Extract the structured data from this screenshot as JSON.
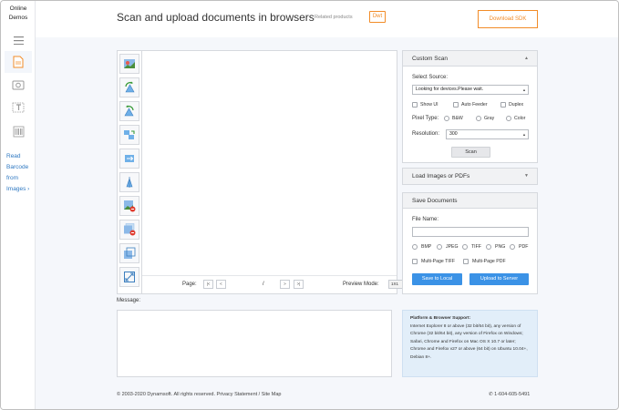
{
  "nav": {
    "brand_line1": "Online",
    "brand_line2": "Demos",
    "icons": [
      "menu-icon",
      "scan-document-icon",
      "webcam-icon",
      "ocr-text-icon",
      "barcode-icon"
    ],
    "barcode_link": [
      "Read",
      "Barcode",
      "from",
      "Images ›"
    ]
  },
  "header": {
    "title": "Scan and upload documents in browsers",
    "related_label": "Related products",
    "related_logo": "Dwt",
    "download_button": "Download SDK",
    "accent_color": "#f28c28"
  },
  "viewer": {
    "tools": [
      "select-image-icon",
      "rotate-left-icon",
      "rotate-right-icon",
      "mirror-icon",
      "flip-icon",
      "crop-icon",
      "remove-image-icon",
      "remove-all-icon",
      "change-size-icon",
      "fit-window-icon"
    ],
    "page_label": "Page:",
    "first_btn": "|<",
    "prev_btn": "<",
    "current_page": "",
    "page_separator": "/",
    "total_pages": "",
    "next_btn": ">",
    "last_btn": ">|",
    "preview_label": "Preview Mode:",
    "preview_value": "1X1"
  },
  "message": {
    "label": "Message:"
  },
  "custom_scan": {
    "title": "Custom Scan",
    "caret": "▲",
    "source_label": "Select Source:",
    "source_value": "Looking for devices.Please wait.",
    "options": [
      "Show UI",
      "Auto Feeder",
      "Duplex"
    ],
    "pixel_type_label": "Pixel Type:",
    "pixel_types": [
      "B&W",
      "Gray",
      "Color"
    ],
    "resolution_label": "Resolution:",
    "resolution_value": "300",
    "scan_button": "Scan"
  },
  "load_panel": {
    "title": "Load Images or PDFs",
    "caret": "▼"
  },
  "save_panel": {
    "title": "Save Documents",
    "file_name_label": "File Name:",
    "file_name_value": "",
    "formats": [
      "BMP",
      "JPEG",
      "TIFF",
      "PNG",
      "PDF"
    ],
    "multipage": [
      "Multi-Page TIFF",
      "Multi-Page PDF"
    ],
    "save_local_button": "Save to Local",
    "upload_button": "Upload to Server",
    "button_color": "#3b92e6"
  },
  "support": {
    "title": "Platform & Browser Support:",
    "text": "Internet Explorer 8 or above (32 bit/64 bit), any version of Chrome (32 bit/64 bit), any version of Firefox on Windows; Safari, Chrome and Firefox on Mac OS X 10.7 or later; Chrome and Firefox v27 or above (64 bit) on Ubuntu 10.04+, Debian 8+."
  },
  "footer": {
    "copyright": "© 2003-2020 Dynamsoft. All rights reserved. Privacy Statement / Site Map",
    "phone": "1-604-605-5491"
  }
}
